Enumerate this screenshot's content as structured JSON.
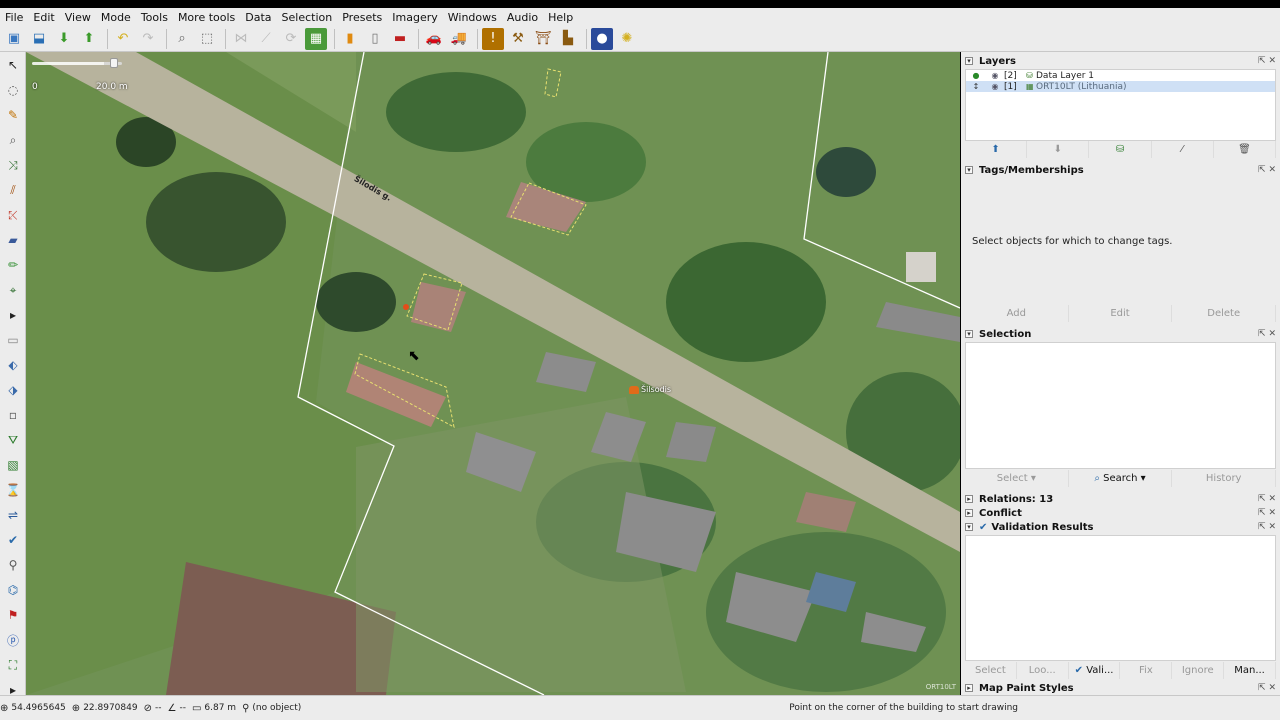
{
  "menu": [
    "File",
    "Edit",
    "View",
    "Mode",
    "Tools",
    "More tools",
    "Data",
    "Selection",
    "Presets",
    "Imagery",
    "Windows",
    "Audio",
    "Help"
  ],
  "toolbar_icons": [
    "open-icon",
    "save-icon",
    "download-icon",
    "upload-icon",
    "undo-icon",
    "redo-icon",
    "zoom-icon",
    "select-icon",
    "merge-icon",
    "split-icon",
    "refresh-icon",
    "grid-icon",
    "bar-icon",
    "marker-icon",
    "stripe-icon",
    "car-icon",
    "truck-icon",
    "warning-icon",
    "tools-icon",
    "gate-icon",
    "chart-icon",
    "record-icon",
    "sun-icon"
  ],
  "map": {
    "scale_zero": "0",
    "scale_end": "20.0 m",
    "street_label": "Šilodis g.",
    "poi_label": "Šilsodis",
    "copyright": "ORT10LT"
  },
  "layers": {
    "title": "Layers",
    "items": [
      {
        "num": "[2]",
        "name": "Data Layer 1"
      },
      {
        "num": "[1]",
        "name": "ORT10LT (Lithuania)"
      }
    ]
  },
  "tags": {
    "title": "Tags/Memberships",
    "empty_msg": "Select objects for which to change tags.",
    "add": "Add",
    "edit": "Edit",
    "delete": "Delete"
  },
  "selection": {
    "title": "Selection",
    "select": "Select",
    "search": "Search",
    "history": "History"
  },
  "relations": {
    "title": "Relations: 13"
  },
  "conflict": {
    "title": "Conflict"
  },
  "validation": {
    "title": "Validation Results",
    "select": "Select",
    "lookup": "Loo...",
    "validate": "Vali...",
    "fix": "Fix",
    "ignore": "Ignore",
    "manage": "Man..."
  },
  "map_paint": {
    "title": "Map Paint Styles"
  },
  "status": {
    "lat": "54.4965645",
    "lon": "22.8970849",
    "heading": "--",
    "angle": "--",
    "length": "6.87 m",
    "object": "(no object)",
    "message": "Point on the corner of the building to start drawing"
  }
}
